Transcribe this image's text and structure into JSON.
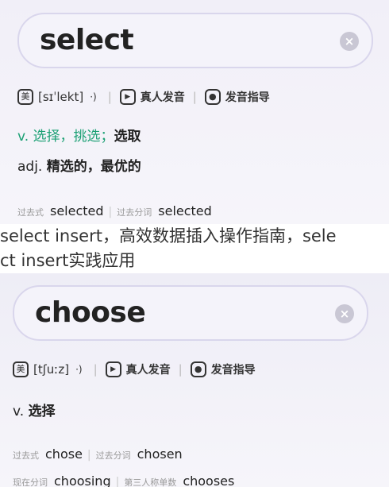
{
  "card1": {
    "word": "select",
    "clear_label": "×",
    "pronunciation_badge": "美",
    "phonetic": "[sɪˈlekt]",
    "speaker_label": "·)",
    "play_label": "▶",
    "real_voice_label": "真人发音",
    "guide_label": "发音指导",
    "definitions": [
      {
        "pos": "v.",
        "meaning_highlight": "选择，挑选；",
        "meaning": "选取"
      },
      {
        "pos": "adj.",
        "meaning": "精选的，最优的"
      }
    ],
    "forms": [
      {
        "label": "过去式",
        "value": "selected"
      },
      {
        "label": "过去分词",
        "value": "selected"
      }
    ]
  },
  "overlay_text": {
    "line1": "select insert，高效数据插入操作指南，sele",
    "line2": "ct insert实践应用"
  },
  "card2": {
    "word": "choose",
    "clear_label": "×",
    "pronunciation_badge": "美",
    "phonetic": "[tʃuːz]",
    "speaker_label": "·)",
    "play_label": "▶",
    "real_voice_label": "真人发音",
    "guide_label": "发音指导",
    "definitions": [
      {
        "pos": "v.",
        "meaning": "选择"
      }
    ],
    "forms_row1": [
      {
        "label": "过去式",
        "value": "chose"
      },
      {
        "label": "过去分词",
        "value": "chosen"
      }
    ],
    "forms_row2": [
      {
        "label": "现在分词",
        "value": "choosing"
      },
      {
        "label": "第三人称单数",
        "value": "chooses"
      }
    ]
  }
}
